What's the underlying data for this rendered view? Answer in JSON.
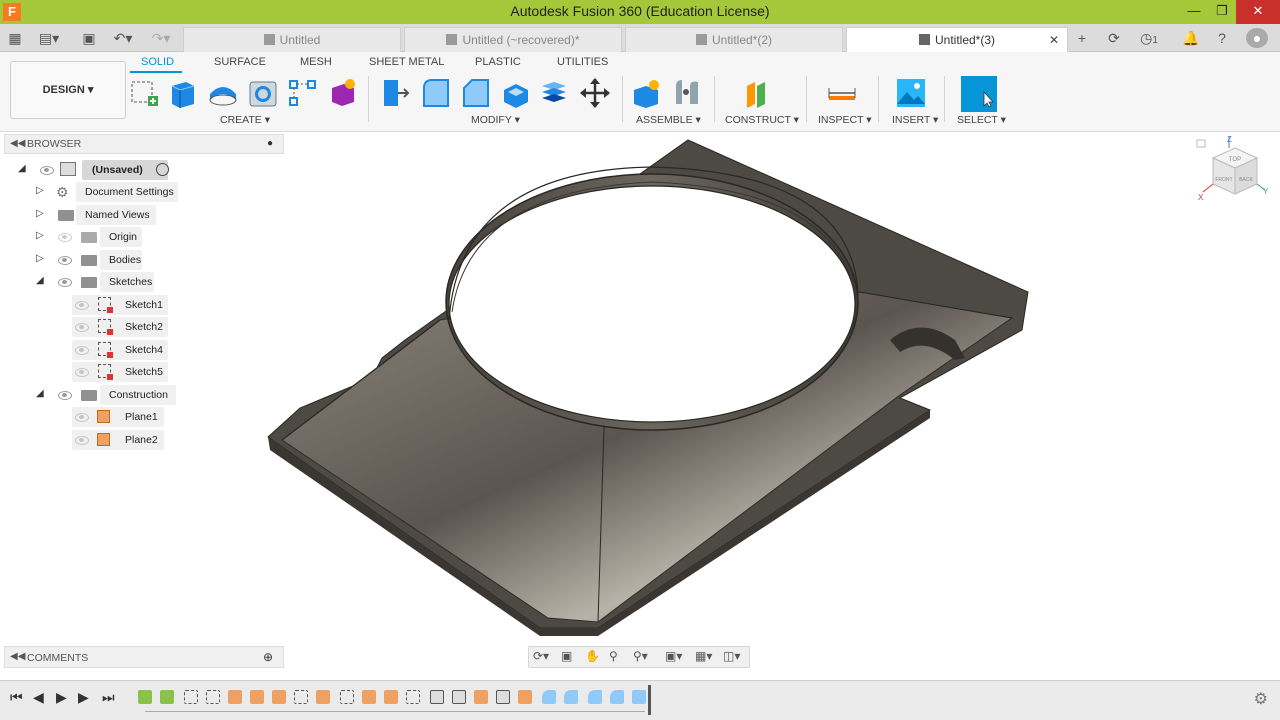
{
  "window": {
    "title": "Autodesk Fusion 360 (Education License)",
    "logo": "F"
  },
  "tabs": [
    {
      "label": "Untitled"
    },
    {
      "label": "Untitled (~recovered)*"
    },
    {
      "label": "Untitled*(2)"
    },
    {
      "label": "Untitled*(3)"
    }
  ],
  "tabbar_right": {
    "jobs_count": "1"
  },
  "workspace": {
    "label": "DESIGN"
  },
  "ribbon_tabs": [
    "SOLID",
    "SURFACE",
    "MESH",
    "SHEET METAL",
    "PLASTIC",
    "UTILITIES"
  ],
  "ribbon_groups": [
    "CREATE",
    "MODIFY",
    "ASSEMBLE",
    "CONSTRUCT",
    "INSPECT",
    "INSERT",
    "SELECT"
  ],
  "browser": {
    "title": "BROWSER",
    "root": "(Unsaved)",
    "items": [
      "Document Settings",
      "Named Views",
      "Origin",
      "Bodies",
      "Sketches",
      "Sketch1",
      "Sketch2",
      "Sketch4",
      "Sketch5",
      "Construction",
      "Plane1",
      "Plane2"
    ]
  },
  "comments": {
    "title": "COMMENTS"
  },
  "viewcube": {
    "top": "TOP",
    "front": "FRONT",
    "back": "BACK",
    "x": "X",
    "y": "Y",
    "z": "Z"
  },
  "colors": {
    "titlebar": "#a4c83a",
    "accent": "#0696d7",
    "model": "#5a554e"
  }
}
